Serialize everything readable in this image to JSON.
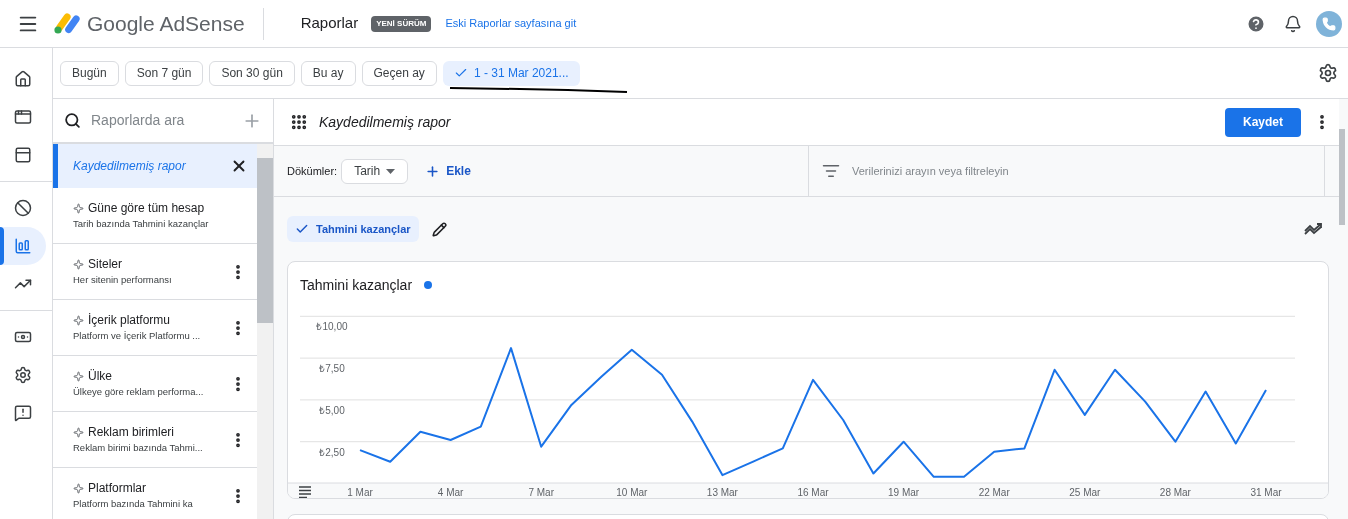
{
  "header": {
    "product": "Google AdSense",
    "page_title": "Raporlar",
    "badge": "YENİ SÜRÜM",
    "old_reports_link": "Eski Raporlar sayfasına git"
  },
  "nav_groups": [
    [
      {
        "kind": "home",
        "selected": false
      },
      {
        "kind": "ads",
        "selected": false
      },
      {
        "kind": "layout",
        "selected": false
      }
    ],
    [
      {
        "kind": "block",
        "selected": false
      },
      {
        "kind": "reports",
        "selected": true
      },
      {
        "kind": "trend",
        "selected": false
      }
    ],
    [
      {
        "kind": "payments",
        "selected": false
      },
      {
        "kind": "settings",
        "selected": false
      },
      {
        "kind": "feedback",
        "selected": false
      }
    ]
  ],
  "date_presets": [
    {
      "label": "Bugün",
      "selected": false
    },
    {
      "label": "Son 7 gün",
      "selected": false
    },
    {
      "label": "Son 30 gün",
      "selected": false
    },
    {
      "label": "Bu ay",
      "selected": false
    },
    {
      "label": "Geçen ay",
      "selected": false
    },
    {
      "label": "1 - 31 Mar 2021...",
      "selected": true
    }
  ],
  "reports_panel": {
    "search_placeholder": "Raporlarda ara",
    "items": [
      {
        "title": "Kaydedilmemiş rapor",
        "selected": true
      },
      {
        "title": "Güne göre tüm hesap",
        "subtitle": "Tarih bazında Tahmini kazançlar",
        "selected": false,
        "menu": false
      },
      {
        "title": "Siteler",
        "subtitle": "Her sitenin performansı",
        "selected": false,
        "menu": true
      },
      {
        "title": "İçerik platformu",
        "subtitle": "Platform ve İçerik Platformu ...",
        "selected": false,
        "menu": true
      },
      {
        "title": "Ülke",
        "subtitle": "Ülkeye göre reklam performa...",
        "selected": false,
        "menu": true
      },
      {
        "title": "Reklam birimleri",
        "subtitle": "Reklam birimi bazında Tahmi...",
        "selected": false,
        "menu": true
      },
      {
        "title": "Platformlar",
        "subtitle": "Platform bazında Tahmini ka",
        "selected": false,
        "menu": true
      }
    ]
  },
  "report": {
    "title": "Kaydedilmemiş rapor",
    "save_button": "Kaydet",
    "breakdown_label": "Dökümler:",
    "breakdown_value": "Tarih",
    "add_button": "Ekle",
    "filter_placeholder": "Verilerinizi arayın veya filtreleyin",
    "metric_chips": [
      {
        "label": "Tahmini kazançlar",
        "checked": true
      }
    ],
    "chart_card": {
      "title": "Tahmini kazançlar",
      "chart_data": {
        "type": "line",
        "categories": [
          "1 Mar",
          null,
          null,
          "4 Mar",
          null,
          null,
          "7 Mar",
          null,
          null,
          "10 Mar",
          null,
          null,
          "13 Mar",
          null,
          null,
          "16 Mar",
          null,
          null,
          "19 Mar",
          null,
          null,
          "22 Mar",
          null,
          null,
          "25 Mar",
          null,
          null,
          "28 Mar",
          null,
          null,
          "31 Mar"
        ],
        "series": [
          {
            "color": "#1a73e8",
            "values": [
              2.0,
              1.3,
              3.1,
              2.6,
              3.4,
              8.1,
              2.2,
              4.7,
              6.4,
              8.0,
              6.5,
              3.7,
              0.5,
              1.3,
              2.1,
              6.2,
              3.8,
              0.6,
              2.5,
              0.4,
              0.4,
              1.9,
              2.1,
              6.8,
              4.1,
              6.8,
              4.9,
              2.5,
              5.5,
              2.4,
              5.6
            ]
          }
        ],
        "ylim": [
          0,
          10
        ],
        "grid": true,
        "yticks": [
          {
            "value": 2.5,
            "label": "₺2,50"
          },
          {
            "value": 5,
            "label": "₺5,00"
          },
          {
            "value": 7.5,
            "label": "₺7,50"
          },
          {
            "value": 10,
            "label": "₺10,00"
          }
        ]
      }
    }
  }
}
